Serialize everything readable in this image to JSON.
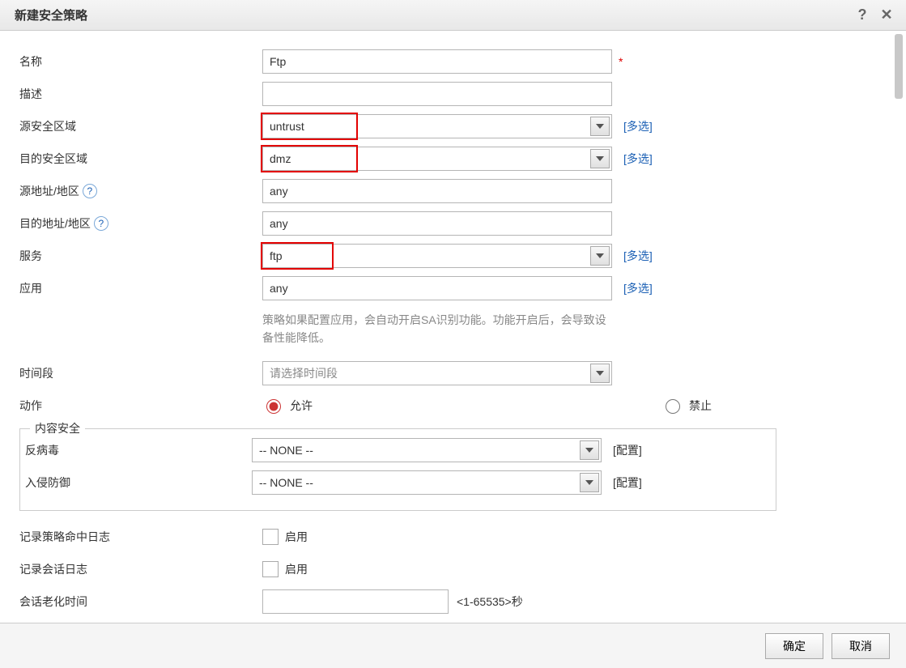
{
  "dialog": {
    "title": "新建安全策略"
  },
  "labels": {
    "name": "名称",
    "description": "描述",
    "src_zone": "源安全区域",
    "dst_zone": "目的安全区域",
    "src_addr": "源地址/地区",
    "dst_addr": "目的地址/地区",
    "service": "服务",
    "application": "应用",
    "time_range": "时间段",
    "action": "动作",
    "content_security": "内容安全",
    "antivirus": "反病毒",
    "ips": "入侵防御",
    "log_hit": "记录策略命中日志",
    "log_session": "记录会话日志",
    "aging": "会话老化时间"
  },
  "values": {
    "name": "Ftp",
    "description": "",
    "src_zone": "untrust",
    "dst_zone": "dmz",
    "src_addr": "any",
    "dst_addr": "any",
    "service": "ftp",
    "application": "any",
    "time_placeholder": "请选择时间段",
    "antivirus": "-- NONE --",
    "ips": "-- NONE --",
    "aging": ""
  },
  "links": {
    "multi": "[多选]",
    "config": "[配置]"
  },
  "hints": {
    "app": "策略如果配置应用，会自动开启SA识别功能。功能开启后，会导致设备性能降低。",
    "aging_unit": "<1-65535>秒"
  },
  "actions": {
    "permit": "允许",
    "deny": "禁止",
    "enable": "启用"
  },
  "buttons": {
    "ok": "确定",
    "cancel": "取消"
  }
}
